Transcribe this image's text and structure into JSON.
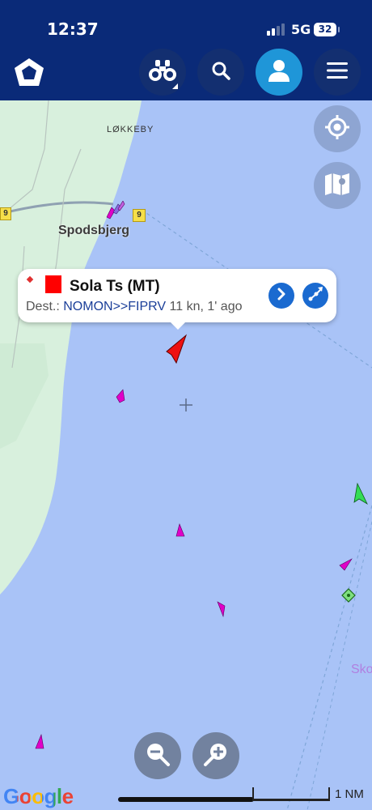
{
  "status": {
    "time": "12:37",
    "network": "5G",
    "battery": "32"
  },
  "toolbar": {
    "logo_icon": "pentagon-logo-icon",
    "binoculars_icon": "binoculars-icon",
    "search_icon": "search-icon",
    "profile_icon": "user-icon",
    "menu_icon": "menu-icon"
  },
  "map": {
    "place_labels": [
      "LØKKEBY",
      "Spodsbjerg",
      "Sko"
    ],
    "road_shields": [
      "9",
      "9"
    ],
    "controls": [
      "locate-icon",
      "map-layers-icon"
    ],
    "zoom_out_icon": "zoom-out-icon",
    "zoom_in_icon": "zoom-in-icon",
    "attribution": "Google",
    "scale": "1 NM",
    "colors": {
      "sea": "#a9c3f7",
      "land": "#d8f0dd",
      "vessel_tanker": "#e000c8",
      "vessel_selected": "#ee1111",
      "vessel_cargo": "#33dd55"
    }
  },
  "popup": {
    "vessel_name": "Sola Ts (MT)",
    "dest_label": "Dest.:",
    "dest_value": "NOMON>>FIPRV",
    "speed_age": "11 kn, 1' ago",
    "flag_color": "#ff0000",
    "details_icon": "chevron-right-icon",
    "route_icon": "route-icon"
  }
}
